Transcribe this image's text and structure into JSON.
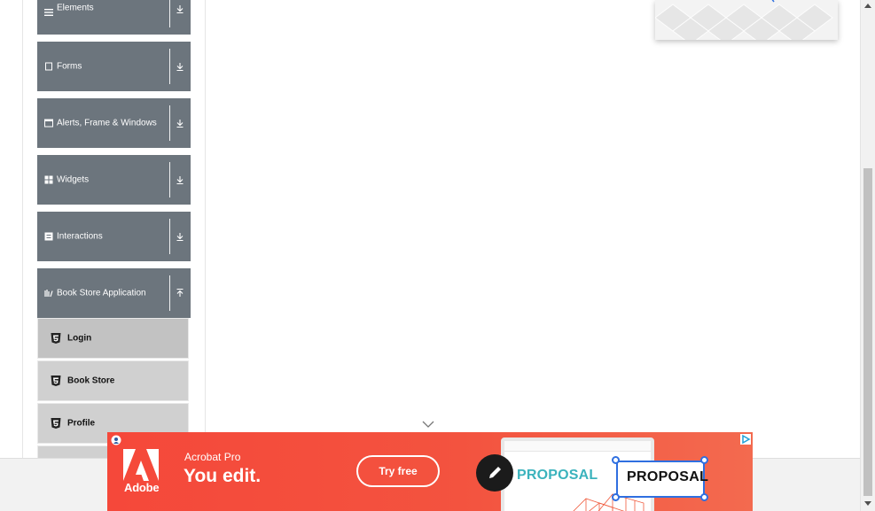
{
  "sidebar": {
    "groups": [
      {
        "label": "Elements",
        "icon": "list-icon",
        "expanded": false
      },
      {
        "label": "Forms",
        "icon": "form-icon",
        "expanded": false
      },
      {
        "label": "Alerts, Frame & Windows",
        "icon": "window-icon",
        "expanded": false
      },
      {
        "label": "Widgets",
        "icon": "grid-icon",
        "expanded": false
      },
      {
        "label": "Interactions",
        "icon": "interaction-icon",
        "expanded": false
      },
      {
        "label": "Book Store Application",
        "icon": "book-icon",
        "expanded": true
      }
    ],
    "book_store_items": [
      {
        "label": "Login",
        "icon": "html5-icon",
        "active": true
      },
      {
        "label": "Book Store",
        "icon": "html5-icon",
        "active": false
      },
      {
        "label": "Profile",
        "icon": "html5-icon",
        "active": false
      }
    ]
  },
  "ad": {
    "brand": "Adobe",
    "product": "Acrobat Pro",
    "tagline": "You edit.",
    "cta": "Try free",
    "doc_word": "PROPOSAL",
    "edit_word": "PROPOSAL",
    "colors": {
      "background": "#f5483a",
      "accent": "#2f6fe0",
      "doc_text": "#3bb3bd"
    }
  },
  "colors": {
    "sidebar_group": "#6c757d",
    "sidebar_item": "#d0d0d0",
    "sidebar_item_active": "#c2c2c2"
  }
}
